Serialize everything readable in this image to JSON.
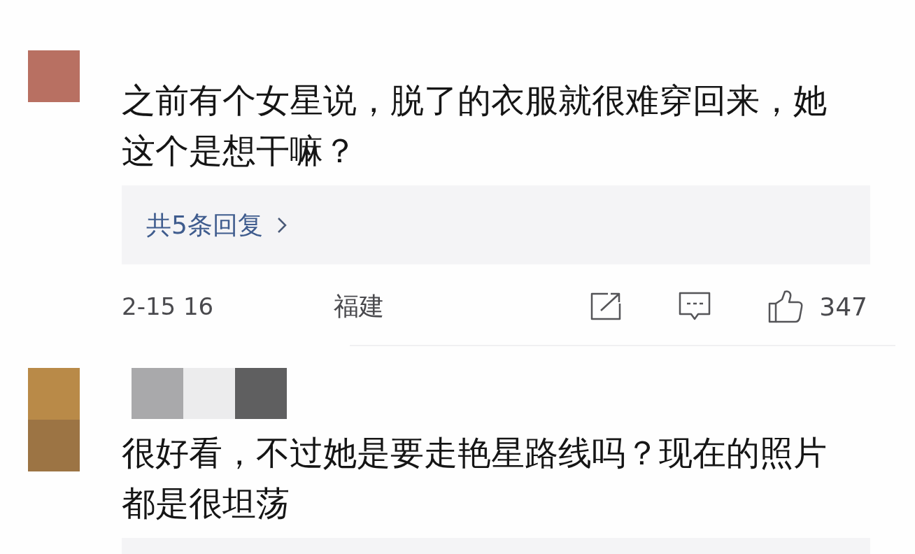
{
  "comments": [
    {
      "avatar_tiles": [
        {
          "color": "#b87062"
        }
      ],
      "text": "之前有个女星说，脱了的衣服就很难穿回来，她这个是想干嘛？",
      "reply_panel": true,
      "replies_label": "共5条回复",
      "footer": {
        "time": "2-15 16",
        "location": "福建",
        "likes": "347"
      }
    },
    {
      "avatar_tiles": [
        {
          "color": "#b98a48"
        },
        {
          "color": "#9c7444"
        }
      ],
      "name_tiles": [
        {
          "color": "#a9a9ab"
        },
        {
          "color": "#ececed"
        },
        {
          "color": "#5f5f60"
        }
      ],
      "text": "很好看，不过她是要走艳星路线吗？现在的照片都是很坦荡",
      "reply_panel": true
    }
  ]
}
